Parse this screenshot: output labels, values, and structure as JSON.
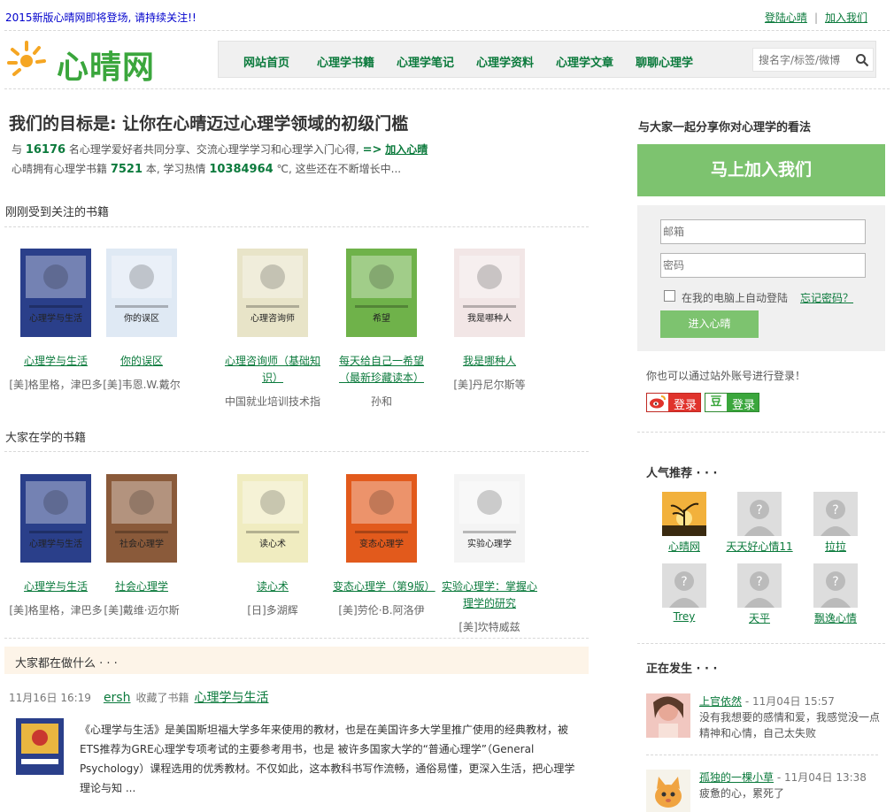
{
  "topbar": {
    "notice": "2015新版心晴网即将登场, 请持续关注!!",
    "login": "登陆心晴",
    "separator": "|",
    "join": "加入我们"
  },
  "logo": {
    "text": "心晴网"
  },
  "nav": {
    "items": [
      "网站首页",
      "心理学书籍",
      "心理学笔记",
      "心理学资料",
      "心理学文章",
      "聊聊心理学"
    ]
  },
  "search": {
    "placeholder": "搜名字/标签/微博"
  },
  "hero": {
    "title": "我们的目标是: 让你在心晴迈过心理学领域的初级门槛",
    "line1_a": "与",
    "members": "16176",
    "line1_b": "名心理学爱好者共同分享、交流心理学学习和心理学入门心得,",
    "join_arrow": "=>",
    "join_link": "加入心晴",
    "line2_a": "心晴拥有心理学书籍",
    "books": "7521",
    "line2_b": "本, 学习热情",
    "heat": "10384964",
    "line2_c": "℃, 这些还在不断增长中..."
  },
  "sections": {
    "recent": "刚刚受到关注的书籍",
    "studying": "大家在学的书籍",
    "feed": "大家都在做什么 · · ·"
  },
  "recent_books": [
    {
      "title": "心理学与生活",
      "author": "[美]格里格，津巴多",
      "cover": "#2a3f8a",
      "cover_text": "心理学与生活"
    },
    {
      "title": "你的误区",
      "author": "[美]韦恩.W.戴尔",
      "cover": "#dfe9f4",
      "cover_text": "你的误区"
    },
    {
      "title": "心理咨询师（基础知识）",
      "author": "中国就业培训技术指",
      "cover": "#e8e4c8",
      "cover_text": "心理咨询师"
    },
    {
      "title": "每天给自己一希望（最新珍藏读本）",
      "author": "孙和",
      "cover": "#6fb24a",
      "cover_text": "希望"
    },
    {
      "title": "我是哪种人",
      "author": "[美]丹尼尔斯等",
      "cover": "#f2e6e6",
      "cover_text": "我是哪种人"
    }
  ],
  "studying_books": [
    {
      "title": "心理学与生活",
      "author": "[美]格里格，津巴多",
      "cover": "#2a3f8a",
      "cover_text": "心理学与生活"
    },
    {
      "title": "社会心理学",
      "author": "[美]戴维·迈尔斯",
      "cover": "#8a5a3a",
      "cover_text": "社会心理学"
    },
    {
      "title": "读心术",
      "author": "[日]多湖辉",
      "cover": "#f0ecc0",
      "cover_text": "读心术"
    },
    {
      "title": "变态心理学（第9版）",
      "author": "[美]劳伦·B.阿洛伊",
      "cover": "#e25a1c",
      "cover_text": "变态心理学"
    },
    {
      "title": "实验心理学：掌握心理学的研究",
      "author": "[美]坎特威兹",
      "cover": "#f4f4f4",
      "cover_text": "实验心理学"
    }
  ],
  "feed": {
    "time": "11月16日 16:19",
    "user": "ersh",
    "action": "收藏了书籍",
    "book": "心理学与生活",
    "text": "《心理学与生活》是美国斯坦福大学多年来使用的教材，也是在美国许多大学里推广使用的经典教材，被ETS推荐为GRE心理学专项考试的主要参考用书，也是 被许多国家大学的“普通心理学”（General Psychology）课程选用的优秀教材。不仅如此，这本教科书写作流畅，通俗易懂，更深入生活，把心理学理论与知 ..."
  },
  "sidebar": {
    "share_title": "与大家一起分享你对心理学的看法",
    "join_button": "马上加入我们",
    "email_placeholder": "邮箱",
    "password_placeholder": "密码",
    "remember": "在我的电脑上自动登陆",
    "forgot": "忘记密码？",
    "enter": "进入心晴",
    "alt_login": "你也可以通过站外账号进行登录！",
    "weibo_login": "登录",
    "douban_icon": "豆",
    "douban_login": "登录",
    "popular_title": "人气推荐 · · ·",
    "popular_users": [
      "心晴网",
      "天天好心情11",
      "拉拉",
      "Trey",
      "天平",
      "飘逸心情"
    ],
    "happening_title": "正在发生 · · ·",
    "happening": [
      {
        "user": "上官依然",
        "time": "- 11月04日 15:57",
        "text": "没有我想要的感情和爱，我感觉没一点精神和心情，自己太失败"
      },
      {
        "user": "孤独的一棵小草",
        "time": "- 11月04日 13:38",
        "text": "疲惫的心，累死了"
      }
    ]
  },
  "colors": {
    "accent": "#0b7a3c",
    "button": "#7dc36f",
    "notice": "#0000cc"
  }
}
